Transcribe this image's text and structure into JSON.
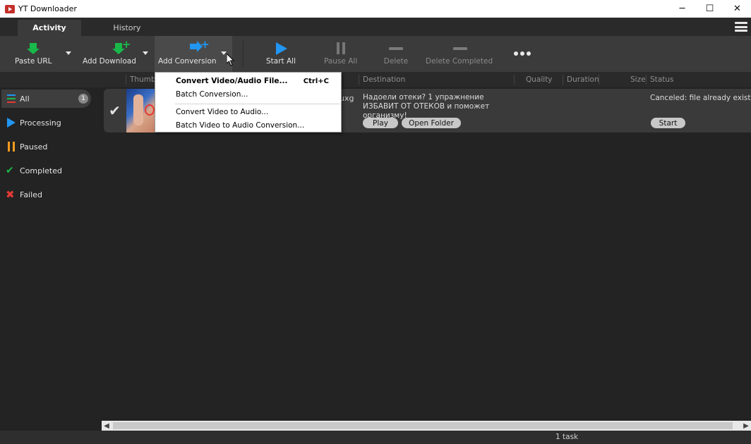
{
  "window": {
    "title": "YT Downloader",
    "controls": {
      "minimize": "─",
      "maximize": "☐",
      "close": "✕"
    }
  },
  "tabs": [
    {
      "label": "Activity",
      "active": true
    },
    {
      "label": "History",
      "active": false
    }
  ],
  "toolbar": {
    "paste_url": "Paste URL",
    "add_download": "Add Download",
    "add_conversion": "Add Conversion",
    "start_all": "Start All",
    "pause_all": "Pause All",
    "delete": "Delete",
    "delete_completed": "Delete Completed"
  },
  "columns": {
    "thumbnail": "Thumbr",
    "destination": "Destination",
    "quality": "Quality",
    "duration": "Duration",
    "size": "Size",
    "status": "Status"
  },
  "sidebar": {
    "items": [
      {
        "label": "All",
        "count": "1",
        "selected": true
      },
      {
        "label": "Processing"
      },
      {
        "label": "Paused"
      },
      {
        "label": "Completed"
      },
      {
        "label": "Failed"
      }
    ]
  },
  "task": {
    "name_fragment": "uxg",
    "destination": "Надоели отеки? 1 упражнение ИЗБАВИТ ОТ ОТЕКОВ и поможет организму!",
    "play_label": "Play",
    "open_folder_label": "Open Folder",
    "status": "Canceled: file already exists",
    "start_label": "Start"
  },
  "menu": {
    "items": [
      {
        "label": "Convert Video/Audio File...",
        "shortcut": "Ctrl+C"
      },
      {
        "label": "Batch Conversion..."
      },
      {
        "label": "Convert Video to Audio..."
      },
      {
        "label": "Batch Video to Audio Conversion..."
      }
    ]
  },
  "statusbar": {
    "text": "1 task"
  },
  "colors": {
    "accent_blue": "#2196f3",
    "success_green": "#19b84a",
    "paused_orange": "#f39c1f",
    "failed_red": "#e53935",
    "background": "#232323",
    "toolbar": "#3b3b3b"
  }
}
